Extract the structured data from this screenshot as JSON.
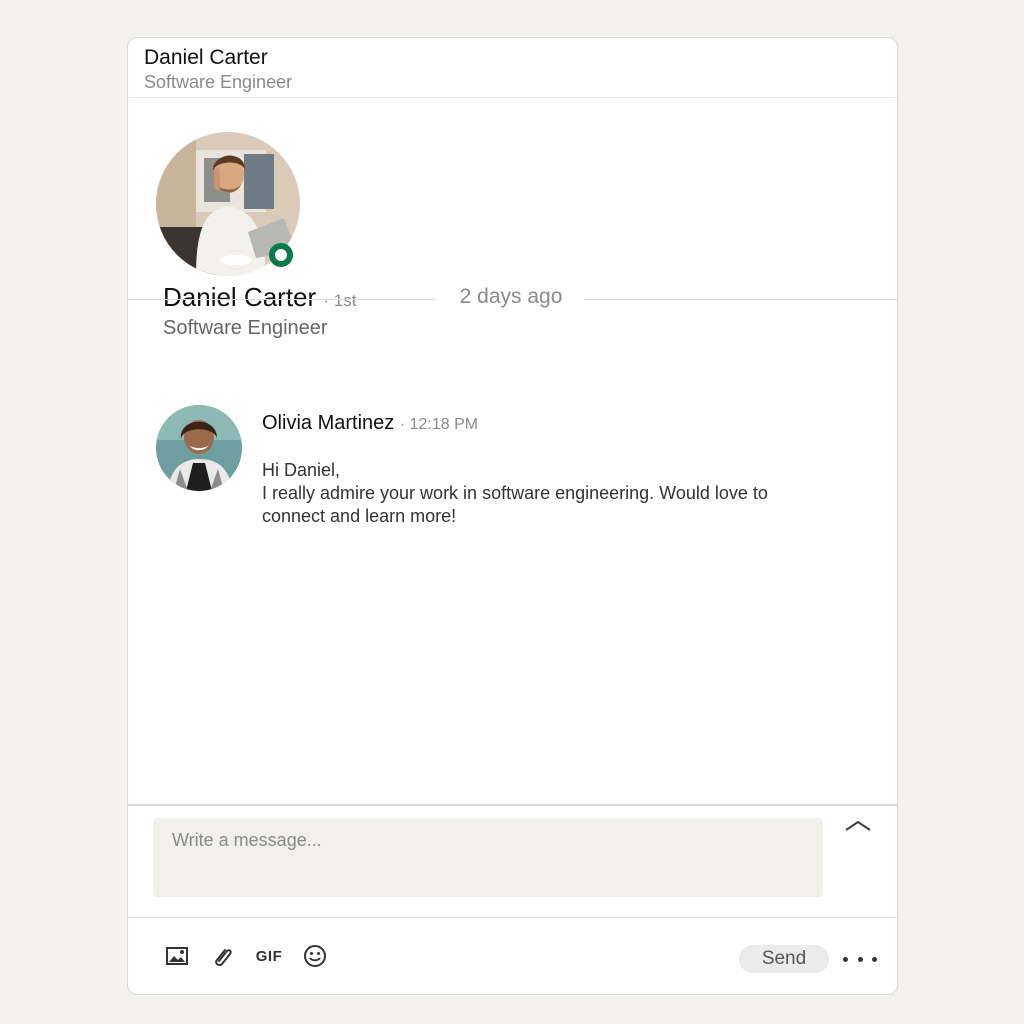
{
  "header": {
    "name": "Daniel Carter",
    "title": "Software Engineer"
  },
  "profile": {
    "name": "Daniel Carter",
    "degree": "· 1st",
    "title": "Software Engineer",
    "status": "online",
    "status_color": "#087a4b"
  },
  "divider": {
    "label": "2 days ago"
  },
  "message": {
    "sender": "Olivia Martinez",
    "time": "· 12:18 PM",
    "line1": "Hi Daniel,",
    "line2": "I really admire your work in software engineering. Would love to connect and learn more!"
  },
  "compose": {
    "placeholder": "Write a message...",
    "value": "",
    "send_label": "Send",
    "gif_label": "GIF",
    "tools": [
      "image-icon",
      "attachment-icon",
      "gif-icon",
      "emoji-icon"
    ]
  }
}
